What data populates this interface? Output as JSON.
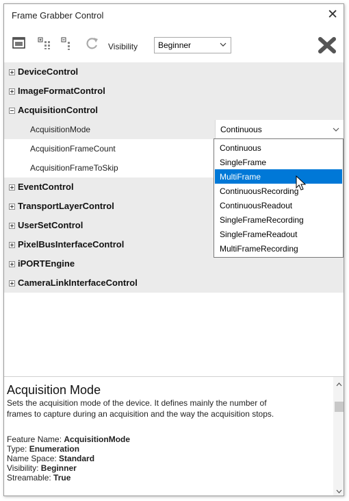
{
  "window": {
    "title": "Frame Grabber Control",
    "close_glyph": "✕"
  },
  "toolbar": {
    "icons": [
      "properties-view-icon",
      "expand-all-icon",
      "collapse-all-icon",
      "refresh-icon"
    ],
    "visibility_label": "Visibility",
    "visibility_value": "Beginner",
    "clear_icon": "big-x-icon"
  },
  "tree": {
    "categories": [
      {
        "label": "DeviceControl",
        "expanded": false
      },
      {
        "label": "ImageFormatControl",
        "expanded": false
      },
      {
        "label": "AcquisitionControl",
        "expanded": true
      },
      {
        "label": "EventControl",
        "expanded": false
      },
      {
        "label": "TransportLayerControl",
        "expanded": false
      },
      {
        "label": "UserSetControl",
        "expanded": false
      },
      {
        "label": "PixelBusInterfaceControl",
        "expanded": false
      },
      {
        "label": "iPORTEngine",
        "expanded": false
      },
      {
        "label": "CameraLinkInterfaceControl",
        "expanded": false
      }
    ],
    "acquisition_props": [
      {
        "label": "AcquisitionMode",
        "value": "Continuous"
      },
      {
        "label": "AcquisitionFrameCount",
        "value": ""
      },
      {
        "label": "AcquisitionFrameToSkip",
        "value": ""
      }
    ]
  },
  "dropdown": {
    "options": [
      "Continuous",
      "SingleFrame",
      "MultiFrame",
      "ContinuousRecording",
      "ContinuousReadout",
      "SingleFrameRecording",
      "SingleFrameReadout",
      "MultiFrameRecording"
    ],
    "highlighted": "MultiFrame"
  },
  "description": {
    "title": "Acquisition Mode",
    "line1": "Sets the acquisition mode of the device. It defines mainly the number of",
    "line2": "frames to capture during an acquisition and the way the acquisition stops.",
    "feature_name_label": "Feature Name: ",
    "feature_name": "AcquisitionMode",
    "type_label": "Type: ",
    "type": "Enumeration",
    "namespace_label": "Name Space: ",
    "namespace": "Standard",
    "visibility_label": "Visibility: ",
    "visibility": "Beginner",
    "streamable_label": "Streamable: ",
    "streamable": "True"
  },
  "colors": {
    "selection": "#0078d7",
    "category_bg": "#ebebeb"
  }
}
